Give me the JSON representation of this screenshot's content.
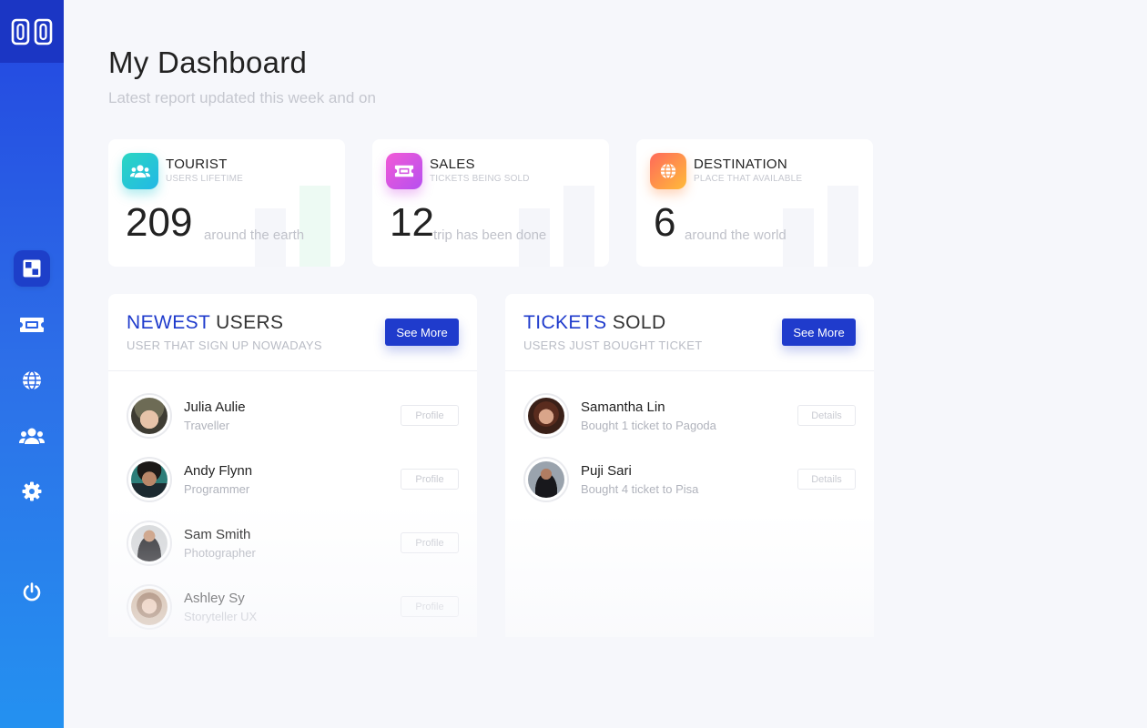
{
  "header": {
    "title": "My Dashboard",
    "subtitle": "Latest report updated this week and on"
  },
  "sidebar": {
    "logo": "00",
    "items": [
      {
        "name": "dashboard",
        "icon": "dashboard-icon",
        "active": true
      },
      {
        "name": "tickets",
        "icon": "ticket-icon",
        "active": false
      },
      {
        "name": "destinations",
        "icon": "globe-icon",
        "active": false
      },
      {
        "name": "users",
        "icon": "users-icon",
        "active": false
      },
      {
        "name": "settings",
        "icon": "gear-icon",
        "active": false
      },
      {
        "name": "logout",
        "icon": "power-icon",
        "active": false
      }
    ]
  },
  "stats": [
    {
      "name": "TOURIST",
      "sub": "USERS LIFETIME",
      "value": "209",
      "caption": "around the earth",
      "icon": "users-icon",
      "color_from": "#2ad6c2",
      "color_to": "#23b8e6"
    },
    {
      "name": "SALES",
      "sub": "TICKETS BEING SOLD",
      "value": "12",
      "caption": "trip has been done",
      "icon": "ticket-icon",
      "color_from": "#f25ad6",
      "color_to": "#b64ff0"
    },
    {
      "name": "DESTINATION",
      "sub": "PLACE THAT AVAILABLE",
      "value": "6",
      "caption": "around the world",
      "icon": "globe-icon",
      "color_from": "#ff7a5a",
      "color_to": "#ffbb3a"
    }
  ],
  "newest_users": {
    "title_highlight": "NEWEST",
    "title_rest": "USERS",
    "subtitle": "USER THAT SIGN UP NOWADAYS",
    "button": "See More",
    "rows": [
      {
        "name": "Julia Aulie",
        "role": "Traveller",
        "action": "Profile"
      },
      {
        "name": "Andy Flynn",
        "role": "Programmer",
        "action": "Profile"
      },
      {
        "name": "Sam Smith",
        "role": "Photographer",
        "action": "Profile"
      },
      {
        "name": "Ashley Sy",
        "role": "Storyteller UX",
        "action": "Profile"
      }
    ]
  },
  "tickets_sold": {
    "title_highlight": "TICKETS",
    "title_rest": "SOLD",
    "subtitle": "USERS JUST BOUGHT TICKET",
    "button": "See More",
    "rows": [
      {
        "name": "Samantha Lin",
        "role": "Bought 1 ticket to Pagoda",
        "action": "Details"
      },
      {
        "name": "Puji Sari",
        "role": "Bought 4 ticket to Pisa",
        "action": "Details"
      }
    ]
  },
  "colors": {
    "accent": "#1f3bcc",
    "sidebar_top": "#2346e0",
    "sidebar_bottom": "#2491f0"
  }
}
